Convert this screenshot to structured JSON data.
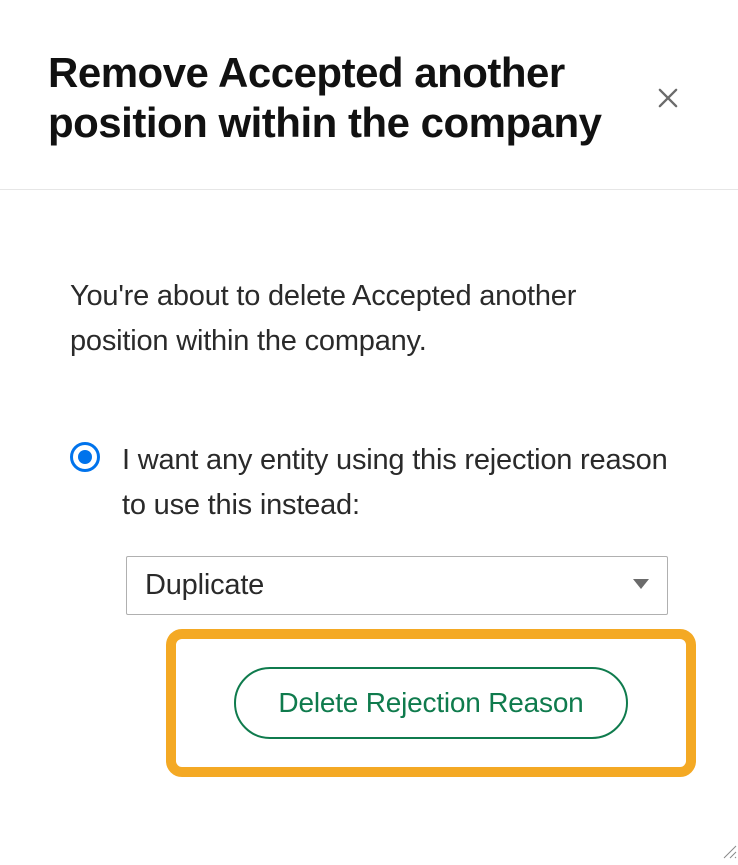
{
  "dialog": {
    "title": "Remove Accepted another position within the company",
    "warning": "You're about to delete Accepted another position within the company.",
    "option_replace_label": "I want any entity using this rejection reason to use this instead:",
    "select_value": "Duplicate",
    "delete_button_label": "Delete Rejection Reason"
  }
}
